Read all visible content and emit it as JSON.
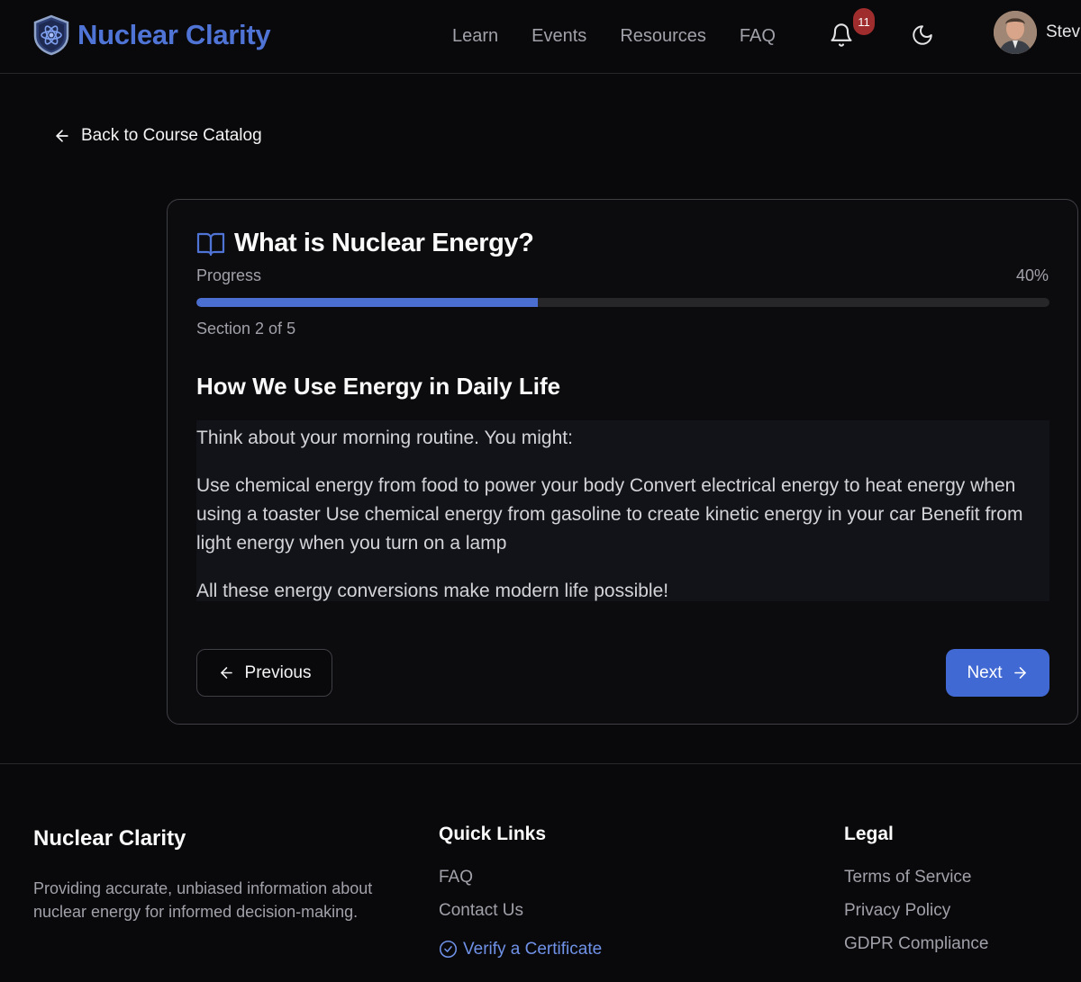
{
  "header": {
    "brand": "Nuclear Clarity",
    "nav": [
      "Learn",
      "Events",
      "Resources",
      "FAQ"
    ],
    "notification_count": "11",
    "user_name": "Stev"
  },
  "back_link": "Back to Course Catalog",
  "lesson": {
    "title": "What is Nuclear Energy?",
    "progress_label": "Progress",
    "progress_value": "40%",
    "progress_fraction": 0.4,
    "section_counter": "Section 2 of 5",
    "section_heading": "How We Use Energy in Daily Life",
    "paragraphs": [
      "Think about your morning routine. You might:",
      "Use chemical energy from food to power your body Convert electrical energy to heat energy when using a toaster Use chemical energy from gasoline to create kinetic energy in your car Benefit from light energy when you turn on a lamp",
      "All these energy conversions make modern life possible!"
    ],
    "previous_label": "Previous",
    "next_label": "Next"
  },
  "footer": {
    "brand_title": "Nuclear Clarity",
    "brand_desc": "Providing accurate, unbiased information about nuclear energy for informed decision-making.",
    "quick_links_heading": "Quick Links",
    "quick_links": [
      "FAQ",
      "Contact Us",
      "Verify a Certificate"
    ],
    "legal_heading": "Legal",
    "legal_links": [
      "Terms of Service",
      "Privacy Policy",
      "GDPR Compliance"
    ]
  },
  "colors": {
    "accent": "#4169d4",
    "brand": "#4f74d6",
    "badge": "#9f2d2d",
    "background": "#09090b"
  },
  "icons": [
    "shield-atom-logo",
    "bell-icon",
    "moon-icon",
    "arrow-left-icon",
    "book-open-icon",
    "arrow-right-icon",
    "check-circle-icon"
  ]
}
